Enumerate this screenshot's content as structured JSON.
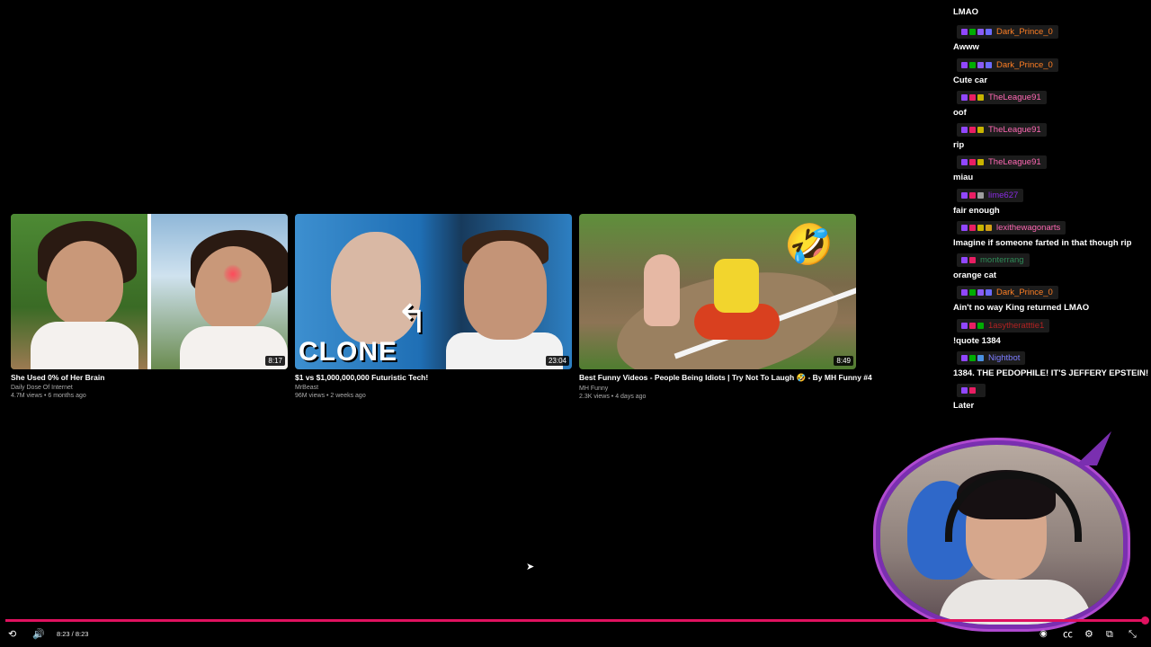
{
  "videos": [
    {
      "title": "She Used 0% of Her Brain",
      "channel": "Daily Dose Of Internet",
      "meta": "4.7M views • 6 months ago",
      "duration": "8:17"
    },
    {
      "title": "$1 vs $1,000,000,000 Futuristic Tech!",
      "channel": "MrBeast",
      "meta": "96M views • 2 weeks ago",
      "duration": "23:04",
      "overlay_text": "CLONE"
    },
    {
      "title": "Best Funny Videos - People Being Idiots | Try Not To Laugh 🤣 - By MH Funny #4",
      "channel": "MH Funny",
      "meta": "2.3K views • 4 days ago",
      "duration": "8:49"
    }
  ],
  "chat": [
    {
      "user": "",
      "text": "LMAO",
      "color": "#ff7f24",
      "badges": []
    },
    {
      "user": "Dark_Prince_0",
      "text": "Awww",
      "color": "#ff7f24",
      "badges": [
        "#9147ff",
        "#00ad03",
        "#8a5cf5",
        "#6b6bff"
      ]
    },
    {
      "user": "Dark_Prince_0",
      "text": "Cute car",
      "color": "#ff7f24",
      "badges": [
        "#9147ff",
        "#00ad03",
        "#8a5cf5",
        "#6b6bff"
      ]
    },
    {
      "user": "TheLeague91",
      "text": "oof",
      "color": "#ff69b4",
      "badges": [
        "#9147ff",
        "#e91e63",
        "#c8b400"
      ]
    },
    {
      "user": "TheLeague91",
      "text": "rip",
      "color": "#ff69b4",
      "badges": [
        "#9147ff",
        "#e91e63",
        "#c8b400"
      ]
    },
    {
      "user": "TheLeague91",
      "text": "miau",
      "color": "#ff69b4",
      "badges": [
        "#9147ff",
        "#e91e63",
        "#c8b400"
      ]
    },
    {
      "user": "lime627",
      "text": "fair enough",
      "color": "#8a2be2",
      "badges": [
        "#9147ff",
        "#e91e63",
        "#9e9e9e"
      ]
    },
    {
      "user": "lexithewagonarts",
      "text": "Imagine if someone farted in that though rip",
      "color": "#ff69b4",
      "badges": [
        "#9147ff",
        "#e91e63",
        "#c8b400",
        "#d4a017"
      ]
    },
    {
      "user": "monterrang",
      "text": "orange cat",
      "color": "#2e8b57",
      "badges": [
        "#9147ff",
        "#e91e63"
      ]
    },
    {
      "user": "Dark_Prince_0",
      "text": "Ain't no way King returned LMAO",
      "color": "#ff7f24",
      "badges": [
        "#9147ff",
        "#00ad03",
        "#8a5cf5",
        "#6b6bff"
      ]
    },
    {
      "user": "1asytheratttie1",
      "text": "!quote 1384",
      "color": "#b22222",
      "badges": [
        "#9147ff",
        "#e91e63",
        "#00ad03"
      ]
    },
    {
      "user": "Nightbot",
      "text": "1384. THE PEDOPHILE! IT'S JEFFERY EPSTEIN!",
      "color": "#7c7cff",
      "badges": [
        "#9147ff",
        "#00ad03",
        "#4a90e2"
      ]
    },
    {
      "user": "",
      "text": "Later",
      "color": "#0000ff",
      "badges": [
        "#9147ff",
        "#e91e63"
      ]
    }
  ],
  "player": {
    "time": "8:23 / 8:23",
    "progress": 1.0,
    "accent": "#e0115f"
  },
  "icons": {
    "replay": "replay-icon",
    "volume": "volume-icon",
    "autoplay": "autoplay-icon",
    "captions": "captions-icon",
    "settings": "settings-icon",
    "cast": "cast-icon",
    "exit_fullscreen": "exit-fullscreen-icon"
  }
}
